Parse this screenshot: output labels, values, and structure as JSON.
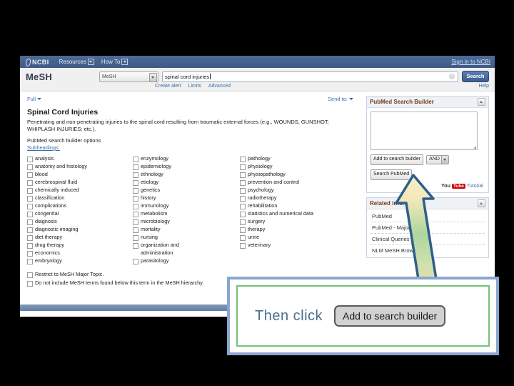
{
  "browser": {
    "topnav": {
      "logo": "NCBI",
      "items": [
        "Resources",
        "How To"
      ],
      "signin": "Sign in to NCBI"
    },
    "search_header": {
      "db_title": "MeSH",
      "db_select_value": "MeSH",
      "term_value": "spinal cord injuries",
      "search_button": "Search",
      "sub_links": [
        "Create alert",
        "Limits",
        "Advanced"
      ],
      "help": "Help"
    },
    "toolbar": {
      "display_format": "Full",
      "send_to": "Send to:"
    },
    "record": {
      "title": "Spinal Cord Injuries",
      "description": "Penetrating and non-penetrating injuries to the spinal cord resulting from traumatic external forces (e.g., WOUNDS, GUNSHOT; WHIPLASH INJURIES; etc.).",
      "builder_options_label": "PubMed search builder options",
      "subheadings_label": "Subheadings:"
    },
    "subheadings": {
      "column1": [
        "analysis",
        "anatomy and histology",
        "blood",
        "cerebrospinal fluid",
        "chemically induced",
        "classification",
        "complications",
        "congenital",
        "diagnosis",
        "diagnostic imaging",
        "diet therapy",
        "drug therapy",
        "economics",
        "embryology"
      ],
      "column2": [
        "enzymology",
        "epidemiology",
        "ethnology",
        "etiology",
        "genetics",
        "history",
        "immunology",
        "metabolism",
        "microbiology",
        "mortality",
        "nursing",
        "organization and\nadministration",
        "parasitology"
      ],
      "column3": [
        "pathology",
        "physiology",
        "physiopathology",
        "prevention and control",
        "psychology",
        "radiotherapy",
        "rehabilitation",
        "statistics and numerical data",
        "surgery",
        "therapy",
        "urine",
        "veterinary"
      ]
    },
    "bottom_options": [
      "Restrict to MeSH Major Topic.",
      "Do not include MeSH terms found below this term in the MeSH hierarchy."
    ],
    "sidebar": {
      "builder": {
        "title": "PubMed Search Builder",
        "textarea_value": "",
        "add_button": "Add to search builder",
        "boolean_value": "AND",
        "search_button": "Search PubMed"
      },
      "youtube": {
        "you": "You",
        "tube": "Tube",
        "tutorial": "Tutorial"
      },
      "related": {
        "title": "Related information",
        "items": [
          "PubMed",
          "PubMed - Major Topic",
          "Clinical Queries",
          "NLM MeSH Browser"
        ]
      }
    }
  },
  "callout": {
    "text": "Then click",
    "button_label": "Add to search builder",
    "outer_border_color": "#8aa6cf",
    "inner_border_color": "#76c277",
    "text_color": "#4a6f8f"
  },
  "arrow": {
    "outline_color": "#2e5f8a",
    "gradient_top": "#faf0c8",
    "gradient_mid": "#a9d49a",
    "gradient_bottom": "#f6dfa0"
  }
}
